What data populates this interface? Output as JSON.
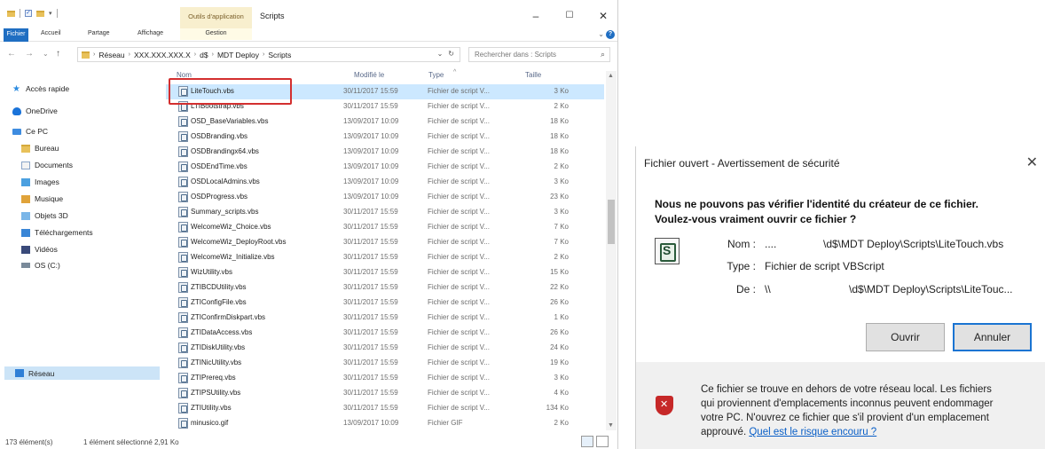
{
  "explorer": {
    "title": "Scripts",
    "tools_tab": "Outils d'application",
    "ribbon_tabs": [
      "Fichier",
      "Accueil",
      "Partage",
      "Affichage",
      "Gestion"
    ],
    "address": {
      "parts": [
        "Réseau",
        "XXX.XXX.XXX.X",
        "d$",
        "MDT Deploy",
        "Scripts"
      ]
    },
    "search_placeholder": "Rechercher dans : Scripts",
    "nav": {
      "quick_access": "Accès rapide",
      "onedrive": "OneDrive",
      "this_pc": "Ce PC",
      "bureau": "Bureau",
      "documents": "Documents",
      "images": "Images",
      "musique": "Musique",
      "objets3d": "Objets 3D",
      "telechargements": "Téléchargements",
      "videos": "Vidéos",
      "os": "OS (C:)",
      "reseau": "Réseau"
    },
    "columns": {
      "name": "Nom",
      "modified": "Modifié le",
      "type": "Type",
      "size": "Taille"
    },
    "files": [
      {
        "name": "LiteTouch.vbs",
        "date": "30/11/2017 15:59",
        "type": "Fichier de script V...",
        "size": "3 Ko"
      },
      {
        "name": "LTIBootstrap.vbs",
        "date": "30/11/2017 15:59",
        "type": "Fichier de script V...",
        "size": "2 Ko"
      },
      {
        "name": "OSD_BaseVariables.vbs",
        "date": "13/09/2017 10:09",
        "type": "Fichier de script V...",
        "size": "18 Ko"
      },
      {
        "name": "OSDBranding.vbs",
        "date": "13/09/2017 10:09",
        "type": "Fichier de script V...",
        "size": "18 Ko"
      },
      {
        "name": "OSDBrandingx64.vbs",
        "date": "13/09/2017 10:09",
        "type": "Fichier de script V...",
        "size": "18 Ko"
      },
      {
        "name": "OSDEndTime.vbs",
        "date": "13/09/2017 10:09",
        "type": "Fichier de script V...",
        "size": "2 Ko"
      },
      {
        "name": "OSDLocalAdmins.vbs",
        "date": "13/09/2017 10:09",
        "type": "Fichier de script V...",
        "size": "3 Ko"
      },
      {
        "name": "OSDProgress.vbs",
        "date": "13/09/2017 10:09",
        "type": "Fichier de script V...",
        "size": "23 Ko"
      },
      {
        "name": "Summary_scripts.vbs",
        "date": "30/11/2017 15:59",
        "type": "Fichier de script V...",
        "size": "3 Ko"
      },
      {
        "name": "WelcomeWiz_Choice.vbs",
        "date": "30/11/2017 15:59",
        "type": "Fichier de script V...",
        "size": "7 Ko"
      },
      {
        "name": "WelcomeWiz_DeployRoot.vbs",
        "date": "30/11/2017 15:59",
        "type": "Fichier de script V...",
        "size": "7 Ko"
      },
      {
        "name": "WelcomeWiz_Initialize.vbs",
        "date": "30/11/2017 15:59",
        "type": "Fichier de script V...",
        "size": "2 Ko"
      },
      {
        "name": "WizUtility.vbs",
        "date": "30/11/2017 15:59",
        "type": "Fichier de script V...",
        "size": "15 Ko"
      },
      {
        "name": "ZTIBCDUtility.vbs",
        "date": "30/11/2017 15:59",
        "type": "Fichier de script V...",
        "size": "22 Ko"
      },
      {
        "name": "ZTIConfigFile.vbs",
        "date": "30/11/2017 15:59",
        "type": "Fichier de script V...",
        "size": "26 Ko"
      },
      {
        "name": "ZTIConfirmDiskpart.vbs",
        "date": "30/11/2017 15:59",
        "type": "Fichier de script V...",
        "size": "1 Ko"
      },
      {
        "name": "ZTIDataAccess.vbs",
        "date": "30/11/2017 15:59",
        "type": "Fichier de script V...",
        "size": "26 Ko"
      },
      {
        "name": "ZTIDiskUtility.vbs",
        "date": "30/11/2017 15:59",
        "type": "Fichier de script V...",
        "size": "24 Ko"
      },
      {
        "name": "ZTINicUtility.vbs",
        "date": "30/11/2017 15:59",
        "type": "Fichier de script V...",
        "size": "19 Ko"
      },
      {
        "name": "ZTIPrereq.vbs",
        "date": "30/11/2017 15:59",
        "type": "Fichier de script V...",
        "size": "3 Ko"
      },
      {
        "name": "ZTIPSUtility.vbs",
        "date": "30/11/2017 15:59",
        "type": "Fichier de script V...",
        "size": "4 Ko"
      },
      {
        "name": "ZTIUtility.vbs",
        "date": "30/11/2017 15:59",
        "type": "Fichier de script V...",
        "size": "134 Ko"
      },
      {
        "name": "minusico.gif",
        "date": "13/09/2017 10:09",
        "type": "Fichier GIF",
        "size": "2 Ko"
      }
    ],
    "status": {
      "count": "173 élément(s)",
      "selection": "1 élément sélectionné  2,91 Ko"
    }
  },
  "dialog": {
    "title": "Fichier ouvert - Avertissement de sécurité",
    "heading_line1": "Nous ne pouvons pas vérifier l'identité du créateur de ce fichier.",
    "heading_line2": "Voulez-vous vraiment ouvrir ce fichier ?",
    "name_label": "Nom :",
    "name_prefix": "....",
    "name_value": "\\d$\\MDT Deploy\\Scripts\\LiteTouch.vbs",
    "type_label": "Type :",
    "type_value": "Fichier de script VBScript",
    "from_label": "De :",
    "from_prefix": "\\\\",
    "from_value": "\\d$\\MDT Deploy\\Scripts\\LiteTouc...",
    "open_button": "Ouvrir",
    "cancel_button": "Annuler",
    "warning_line1": "Ce fichier se trouve en dehors de votre réseau local. Les fichiers",
    "warning_line2": "qui proviennent d'emplacements inconnus peuvent endommager",
    "warning_line3": "votre PC. N'ouvrez ce fichier que s'il provient d'un emplacement",
    "warning_line4": "approuvé.",
    "warning_link": "Quel est le risque encouru ?"
  }
}
